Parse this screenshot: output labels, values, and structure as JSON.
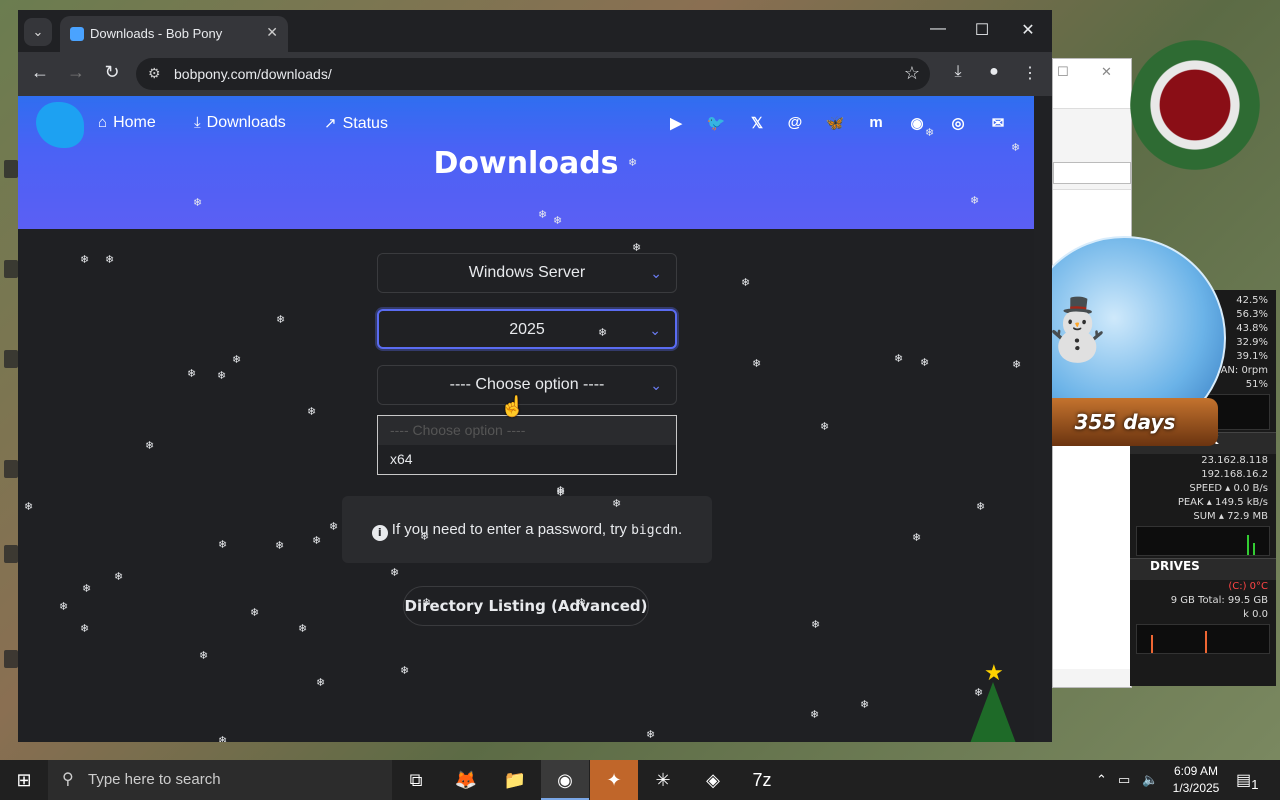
{
  "browser": {
    "tab_title": "Downloads - Bob Pony",
    "url": "bobpony.com/downloads/"
  },
  "site": {
    "nav": [
      {
        "label": "Home",
        "icon": "home-icon"
      },
      {
        "label": "Downloads",
        "icon": "download-icon"
      },
      {
        "label": "Status",
        "icon": "trend-icon"
      }
    ],
    "social_icons": [
      "youtube-icon",
      "twitter-icon",
      "x-icon",
      "threads-icon",
      "bluesky-icon",
      "mastodon-icon",
      "discord-icon",
      "github-icon",
      "email-icon"
    ],
    "page_title": "Downloads"
  },
  "form": {
    "os_select": "Windows Server",
    "version_select": "2025",
    "arch_select": "---- Choose option ----",
    "dropdown_options": [
      {
        "label": "---- Choose option ----",
        "disabled": true
      },
      {
        "label": "x64",
        "disabled": false
      }
    ]
  },
  "alert": {
    "text": "If you need to enter a password, try ",
    "code": "bigcdn",
    "suffix": "."
  },
  "directory_link": "Directory Listing (Advanced)",
  "gadgets": {
    "countdown": "355 days",
    "monitor": {
      "cpu_rows": [
        "42.5%",
        "56.3%",
        "43.8%",
        "32.9%",
        "39.1%",
        "FAN: 0rpm",
        "51%"
      ],
      "network_title": "NETWORK",
      "network_rows": [
        "23.162.8.118",
        "192.168.16.2",
        "SPEED ▴ 0.0 B/s",
        "PEAK ▴ 149.5 kB/s",
        "SUM ▴ 72.9 MB"
      ],
      "drives_title": "DRIVES",
      "drive_rows": [
        "(C:) 0°C",
        "9 GB   Total: 99.5 GB",
        "k   0.0"
      ]
    }
  },
  "taskbar": {
    "search_placeholder": "Type here to search",
    "time": "6:09 AM",
    "date": "1/3/2025",
    "notif_count": "1"
  },
  "colors": {
    "accent": "#5a6cf2",
    "hero_top": "#2f6ef0",
    "hero_bottom": "#5b5ff4",
    "page_bg": "#1f2023"
  }
}
